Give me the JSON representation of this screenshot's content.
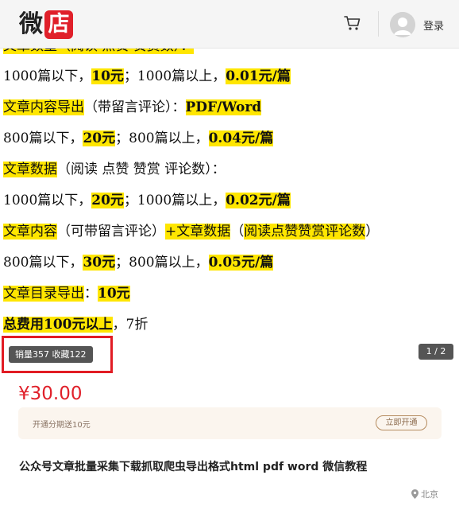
{
  "header": {
    "logo_char": "微",
    "logo_badge": "店",
    "login": "登录"
  },
  "content": {
    "lines": [
      [
        {
          "t": "文章数量（阅读 点赞 赞赏数）：",
          "hl": true
        }
      ],
      [
        {
          "t": "1000篇以下，"
        },
        {
          "t": "10元",
          "hl": true
        },
        {
          "t": "；1000篇以上，"
        },
        {
          "t": "0.01元/篇",
          "hl": true
        }
      ],
      [
        {
          "t": "文章内容导出",
          "hl": true
        },
        {
          "t": "（带留言评论）："
        },
        {
          "t": "PDF/Word",
          "hl": true
        }
      ],
      [
        {
          "t": "800篇以下，"
        },
        {
          "t": "20元",
          "hl": true
        },
        {
          "t": "；800篇以上，"
        },
        {
          "t": "0.04元/篇",
          "hl": true
        }
      ],
      [
        {
          "t": "文章数据",
          "hl": true
        },
        {
          "t": "（阅读 点赞 赞赏 评论数）："
        }
      ],
      [
        {
          "t": "1000篇以下，"
        },
        {
          "t": "20元",
          "hl": true
        },
        {
          "t": "；1000篇以上，"
        },
        {
          "t": "0.02元/篇",
          "hl": true
        }
      ],
      [
        {
          "t": "文章内容",
          "hl": true
        },
        {
          "t": "（可带留言评论）"
        },
        {
          "t": "+文章数据",
          "hl": true
        },
        {
          "t": "（"
        },
        {
          "t": "阅读点赞赞赏评论数",
          "hl": true
        },
        {
          "t": "）"
        }
      ],
      [
        {
          "t": "800篇以下，"
        },
        {
          "t": "30元",
          "hl": true
        },
        {
          "t": "；800篇以上，"
        },
        {
          "t": "0.05元/篇",
          "hl": true
        }
      ],
      [
        {
          "t": "文章目录导出",
          "hl": true
        },
        {
          "t": "："
        },
        {
          "t": "10元",
          "hl": true
        }
      ],
      [
        {
          "t": "总费用100元以上",
          "hl": true
        },
        {
          "t": "，7折"
        }
      ]
    ]
  },
  "stats": {
    "text": "销量357 收藏122",
    "pager": "1 / 2"
  },
  "product": {
    "price": "¥30.00",
    "promo_text": "开通分期送10元",
    "promo_button": "立即开通",
    "title": "公众号文章批量采集下载抓取爬虫导出格式html pdf word 微信教程",
    "location": "北京"
  }
}
